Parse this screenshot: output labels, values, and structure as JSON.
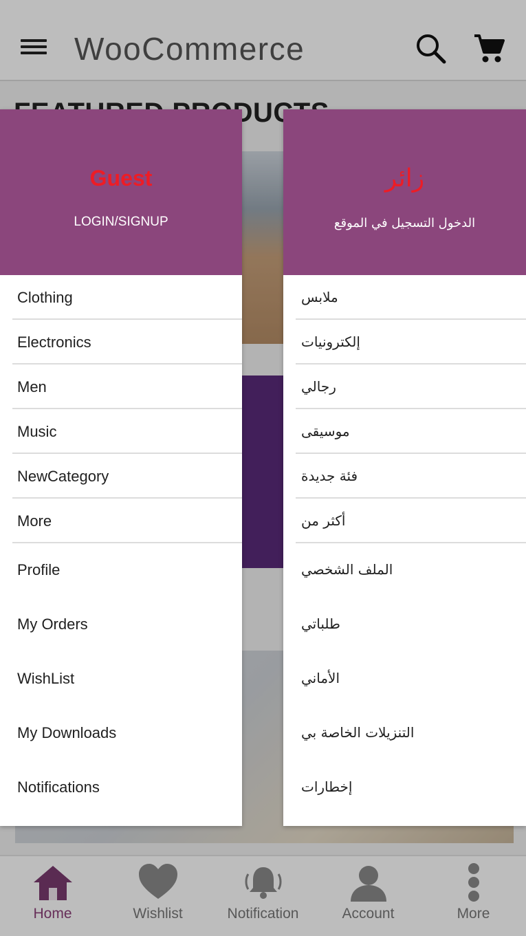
{
  "header": {
    "title": "WooCommerce",
    "menu_icon": "hamburger-menu-icon",
    "search_icon": "search-icon",
    "cart_icon": "shopping-cart-icon"
  },
  "main": {
    "section_title": "FEATURED PRODUCTS"
  },
  "bottom_nav": [
    {
      "label": "Home",
      "icon": "home-icon",
      "active": true
    },
    {
      "label": "Wishlist",
      "icon": "heart-icon",
      "active": false
    },
    {
      "label": "Notification",
      "icon": "bell-icon",
      "active": false
    },
    {
      "label": "Account",
      "icon": "user-icon",
      "active": false
    },
    {
      "label": "More",
      "icon": "more-vertical-icon",
      "active": false
    }
  ],
  "drawer_en": {
    "user_name": "Guest",
    "login_label": "LOGIN/SIGNUP",
    "categories": [
      "Clothing",
      "Electronics",
      "Men",
      "Music",
      "NewCategory",
      "More"
    ],
    "account": [
      "Profile",
      "My Orders",
      "WishList",
      "My Downloads",
      "Notifications"
    ]
  },
  "drawer_ar": {
    "user_name": "زائر",
    "login_label": "الدخول التسجيل في الموقع",
    "categories": [
      "ملابس",
      "إلكترونيات",
      "رجالي",
      "موسيقى",
      "فئة جديدة",
      "أكثر من"
    ],
    "account": [
      "الملف الشخصي",
      "طلباتي",
      "الأماني",
      "التنزيلات الخاصة بي",
      "إخطارات"
    ]
  },
  "colors": {
    "accent": "#8b467c",
    "guest_red": "#ee1c25",
    "active_tab": "#8b3f79"
  }
}
